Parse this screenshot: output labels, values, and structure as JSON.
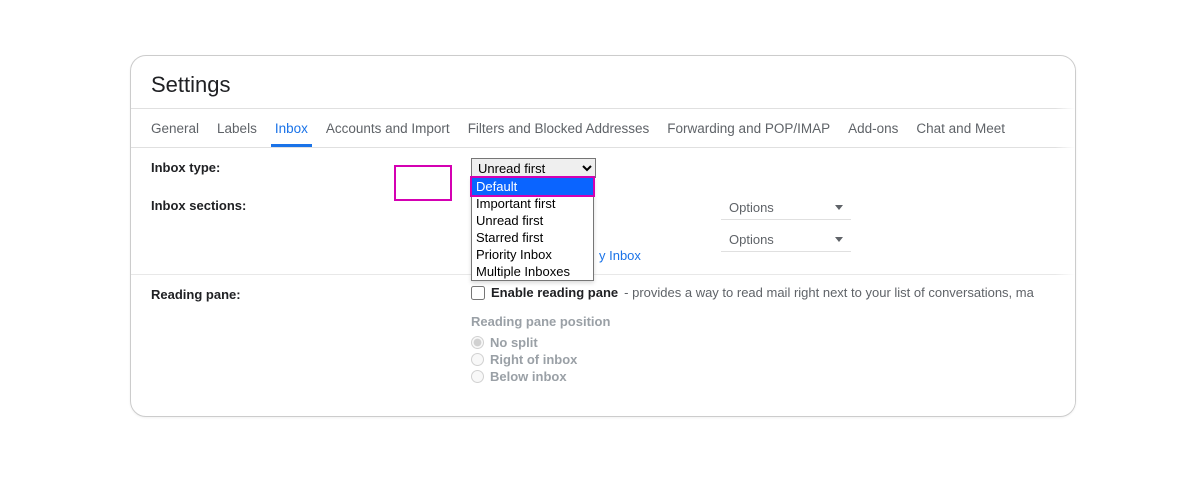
{
  "title": "Settings",
  "tabs": {
    "general": "General",
    "labels": "Labels",
    "inbox": "Inbox",
    "accounts": "Accounts and Import",
    "filters": "Filters and Blocked Addresses",
    "forwarding": "Forwarding and POP/IMAP",
    "addons": "Add-ons",
    "chat": "Chat and Meet"
  },
  "inbox_type": {
    "label": "Inbox type:",
    "selected": "Unread first",
    "options": {
      "default": "Default",
      "important_first": "Important first",
      "unread_first": "Unread first",
      "starred_first": "Starred first",
      "priority_inbox": "Priority Inbox",
      "multiple_inboxes": "Multiple Inboxes"
    }
  },
  "inbox_sections": {
    "label": "Inbox sections:",
    "options_label": "Options",
    "link_partial": "y Inbox"
  },
  "reading_pane": {
    "label": "Reading pane:",
    "enable_label": "Enable reading pane",
    "enable_desc": " - provides a way to read mail right next to your list of conversations, ma",
    "position_title": "Reading pane position",
    "options": {
      "no_split": "No split",
      "right": "Right of inbox",
      "below": "Below inbox"
    }
  }
}
